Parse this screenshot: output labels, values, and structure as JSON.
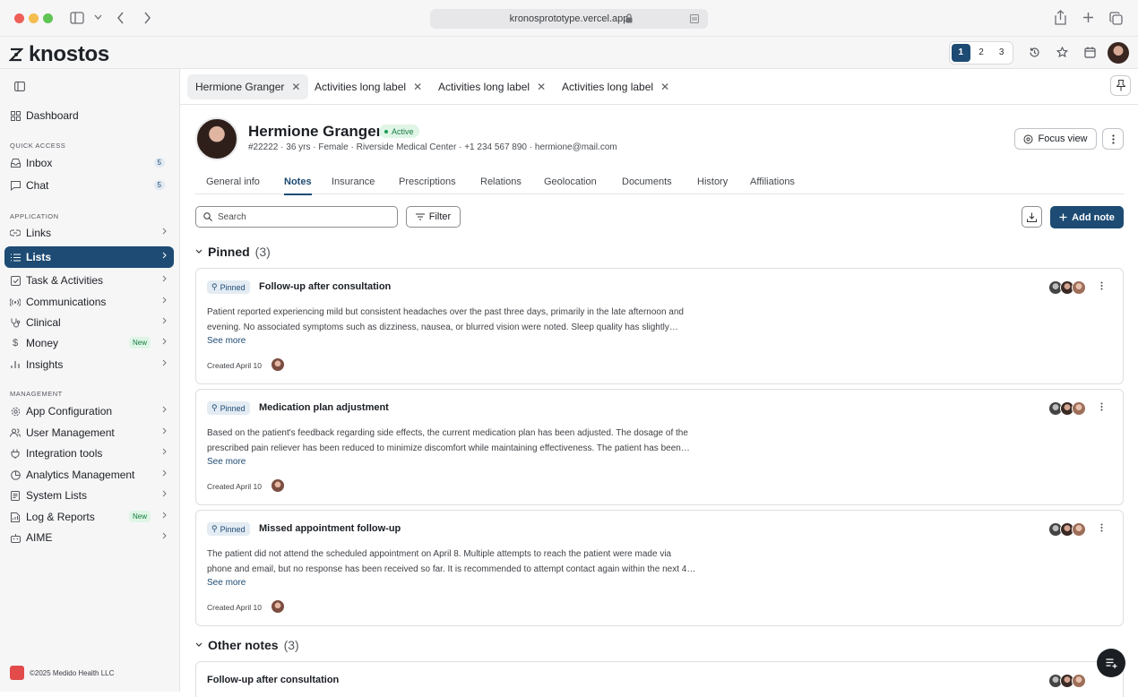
{
  "browser": {
    "url": "kronosprototype.vercel.app"
  },
  "app": {
    "logo": "knostos",
    "workspaces": [
      "1",
      "2",
      "3"
    ]
  },
  "sidebar": {
    "dashboard": "Dashboard",
    "quick_access_label": "QUICK ACCESS",
    "inbox": {
      "label": "Inbox",
      "count": "5"
    },
    "chat": {
      "label": "Chat",
      "count": "5"
    },
    "application_label": "APPLICATION",
    "links": "Links",
    "lists": "Lists",
    "tasks": "Task & Activities",
    "communications": "Communications",
    "clinical": "Clinical",
    "money": {
      "label": "Money",
      "badge": "New"
    },
    "insights": "Insights",
    "management_label": "MANAGEMENT",
    "app_configuration": "App Configuration",
    "user_management": "User Management",
    "integration_tools": "Integration tools",
    "analytics_management": "Analytics Management",
    "system_lists": "System Lists",
    "log_reports": {
      "label": "Log & Reports",
      "badge": "New"
    },
    "aime": "AIME",
    "footer": "©2025 Medido Health LLC"
  },
  "tabs": [
    "Hermione Granger",
    "Activities long label",
    "Activities long label",
    "Activities long label"
  ],
  "patient": {
    "name": "Hermione Granger",
    "status": "Active",
    "info": "#22222 · 36 yrs · Female · Riverside Medical Center · +1 234 567 890 · hermione@mail.com",
    "focus_view": "Focus view"
  },
  "subtabs": [
    "General info",
    "Notes",
    "Insurance",
    "Prescriptions",
    "Relations",
    "Geolocation",
    "Documents",
    "History",
    "Affiliations"
  ],
  "toolbar": {
    "search_placeholder": "Search",
    "filter": "Filter",
    "add_note": "Add note"
  },
  "pinned": {
    "title": "Pinned",
    "count": "(3)",
    "tag": "Pinned",
    "see_more": "See more",
    "notes": [
      {
        "title": "Follow-up after consultation",
        "line1": "Patient reported experiencing mild but consistent headaches over the past three days, primarily in the late afternoon and",
        "line2": "evening. No associated symptoms such as dizziness, nausea, or blurred vision were noted. Sleep quality has slightly…",
        "created": "Created April 10"
      },
      {
        "title": "Medication plan adjustment",
        "line1": "Based on the patient's feedback regarding side effects, the current medication plan has been adjusted. The dosage of the",
        "line2": "prescribed pain reliever has been reduced to minimize discomfort while maintaining effectiveness. The patient has been…",
        "created": "Created April 10"
      },
      {
        "title": "Missed appointment follow-up",
        "line1": "The patient did not attend the scheduled appointment on April 8. Multiple attempts to reach the patient were made via",
        "line2": "phone and email, but no response has been received so far. It is recommended to attempt contact again within the next 4…",
        "created": "Created April 10"
      }
    ]
  },
  "other": {
    "title": "Other notes",
    "count": "(3)",
    "first_title": "Follow-up after consultation"
  },
  "colors": {
    "accent": "#1d4b73",
    "active_green": "#1a9a52",
    "new_badge": "#0f7a3e"
  }
}
